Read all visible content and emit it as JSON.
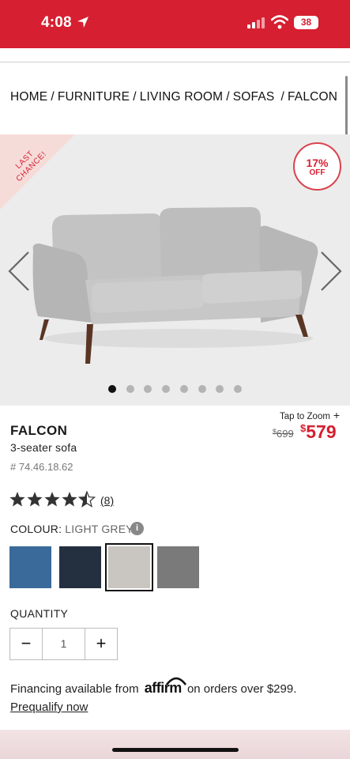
{
  "status_bar": {
    "time": "4:08",
    "battery": "38",
    "bg_color": "#d61f30"
  },
  "breadcrumb": [
    "HOME",
    "FURNITURE",
    "LIVING ROOM",
    "SOFAS",
    "FALCON"
  ],
  "breadcrumb_separator": "/",
  "gallery": {
    "ribbon_text": "LAST CHANCE!",
    "discount_pct": "17%",
    "discount_off": "OFF",
    "image_count": 8,
    "active_index": 0,
    "prev_icon": "chevron-left-icon",
    "next_icon": "chevron-right-icon"
  },
  "zoom_hint": "Tap to Zoom",
  "product": {
    "name": "FALCON",
    "subtitle": "3-seater sofa",
    "sku": "# 74.46.18.62",
    "old_price_currency": "$",
    "old_price": "699",
    "new_price_currency": "$",
    "new_price": "579",
    "price_color": "#d61f30"
  },
  "rating": {
    "stars": 4.5,
    "max": 5,
    "count": "(8)"
  },
  "colour": {
    "label": "COLOUR:",
    "selected": "LIGHT GREY",
    "swatches": [
      {
        "name": "blue",
        "color": "#3a6a9a"
      },
      {
        "name": "navy",
        "color": "#243040"
      },
      {
        "name": "light-grey",
        "color": "#c9c5c0",
        "selected": true
      },
      {
        "name": "dark-grey",
        "color": "#7a7a7a"
      }
    ]
  },
  "quantity": {
    "label": "QUANTITY",
    "minus": "−",
    "value": "1",
    "plus": "+"
  },
  "financing": {
    "prefix": "Financing available from",
    "brand": "affirm",
    "suffix": "on orders over $299.",
    "link": "Prequalify now"
  }
}
